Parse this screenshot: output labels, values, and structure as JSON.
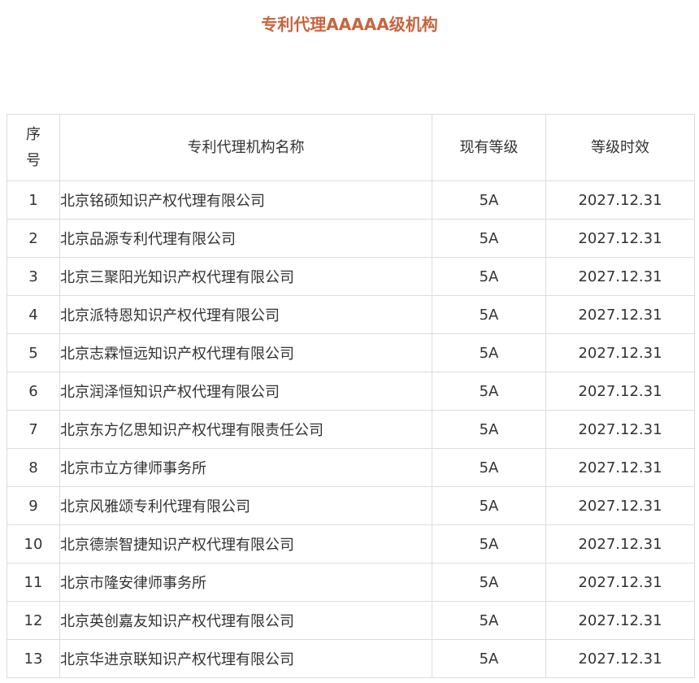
{
  "title": "专利代理AAAAA级机构",
  "table": {
    "headers": {
      "index": "序号",
      "name": "专利代理机构名称",
      "grade": "现有等级",
      "validity": "等级时效"
    },
    "rows": [
      {
        "index": "1",
        "name": "北京铭硕知识产权代理有限公司",
        "grade": "5A",
        "validity": "2027.12.31"
      },
      {
        "index": "2",
        "name": "北京品源专利代理有限公司",
        "grade": "5A",
        "validity": "2027.12.31"
      },
      {
        "index": "3",
        "name": "北京三聚阳光知识产权代理有限公司",
        "grade": "5A",
        "validity": "2027.12.31"
      },
      {
        "index": "4",
        "name": "北京派特恩知识产权代理有限公司",
        "grade": "5A",
        "validity": "2027.12.31"
      },
      {
        "index": "5",
        "name": "北京志霖恒远知识产权代理有限公司",
        "grade": "5A",
        "validity": "2027.12.31"
      },
      {
        "index": "6",
        "name": "北京润泽恒知识产权代理有限公司",
        "grade": "5A",
        "validity": "2027.12.31"
      },
      {
        "index": "7",
        "name": "北京东方亿思知识产权代理有限责任公司",
        "grade": "5A",
        "validity": "2027.12.31"
      },
      {
        "index": "8",
        "name": "北京市立方律师事务所",
        "grade": "5A",
        "validity": "2027.12.31"
      },
      {
        "index": "9",
        "name": "北京风雅颂专利代理有限公司",
        "grade": "5A",
        "validity": "2027.12.31"
      },
      {
        "index": "10",
        "name": "北京德崇智捷知识产权代理有限公司",
        "grade": "5A",
        "validity": "2027.12.31"
      },
      {
        "index": "11",
        "name": "北京市隆安律师事务所",
        "grade": "5A",
        "validity": "2027.12.31"
      },
      {
        "index": "12",
        "name": "北京英创嘉友知识产权代理有限公司",
        "grade": "5A",
        "validity": "2027.12.31"
      },
      {
        "index": "13",
        "name": "北京华进京联知识产权代理有限公司",
        "grade": "5A",
        "validity": "2027.12.31"
      }
    ]
  },
  "colors": {
    "title": "#c8643c",
    "text": "#333333",
    "border": "#dcdcdc"
  }
}
